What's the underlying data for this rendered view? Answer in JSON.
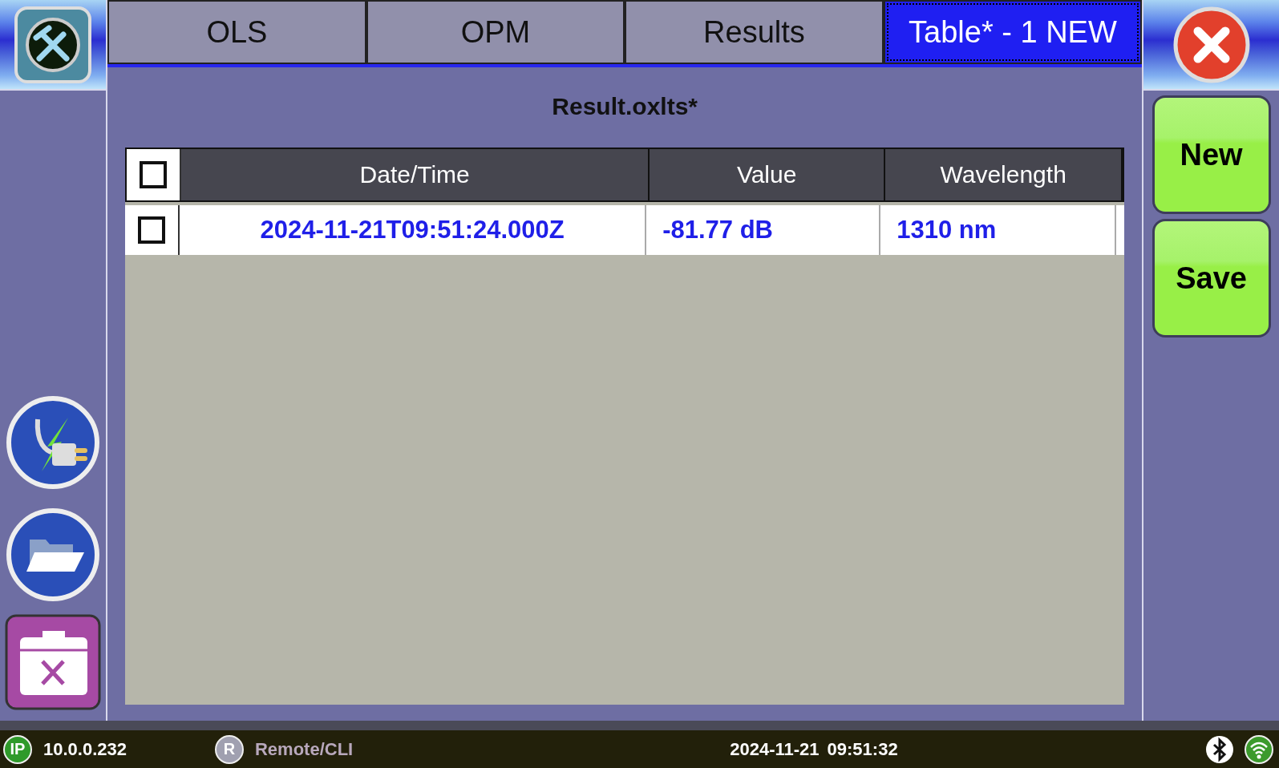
{
  "tabs": [
    {
      "label": "OLS",
      "selected": false
    },
    {
      "label": "OPM",
      "selected": false
    },
    {
      "label": "Results",
      "selected": false
    },
    {
      "label": "Table* - 1 NEW",
      "selected": true
    }
  ],
  "file_title": "Result.oxlts*",
  "table": {
    "select_all_checked": false,
    "columns": [
      "Date/Time",
      "Value",
      "Wavelength"
    ],
    "rows": [
      {
        "checked": false,
        "cells": [
          "2024-11-21T09:51:24.000Z",
          "-81.77 dB",
          "1310 nm"
        ]
      }
    ]
  },
  "actions": [
    "New",
    "Save"
  ],
  "status_bar": {
    "ip_badge": "IP",
    "ip": "10.0.0.232",
    "remote_badge": "R",
    "remote": "Remote/CLI",
    "remote_active": false,
    "date": "2024-11-21",
    "time": "09:51:32"
  }
}
